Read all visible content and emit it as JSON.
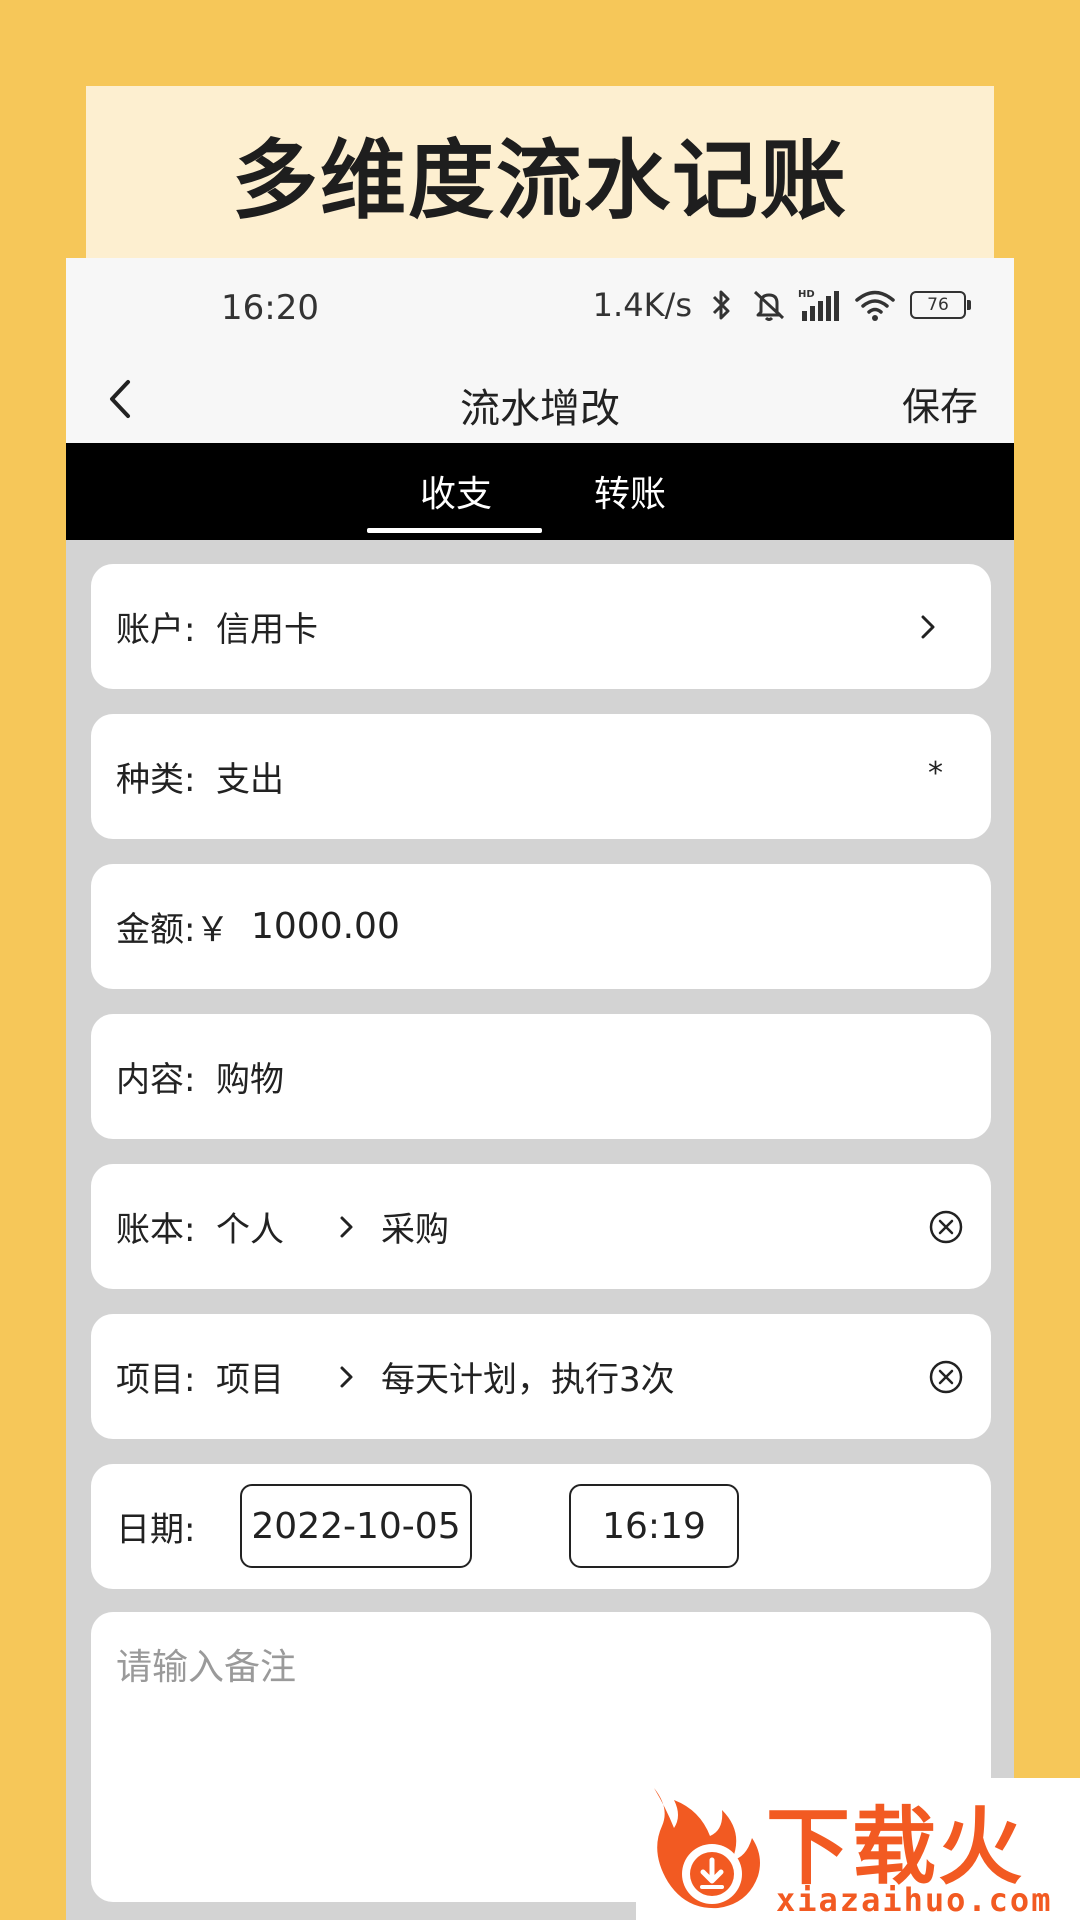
{
  "banner": {
    "title": "多维度流水记账"
  },
  "status_bar": {
    "time": "16:20",
    "speed": "1.4K/s",
    "battery": "76",
    "icons": [
      "bluetooth-icon",
      "mute-icon",
      "hd-signal-icon",
      "wifi-icon",
      "battery-icon"
    ]
  },
  "nav": {
    "title": "流水增改",
    "save": "保存",
    "back_icon": "chevron-left-icon"
  },
  "tabs": [
    {
      "label": "收支",
      "active": true
    },
    {
      "label": "转账",
      "active": false
    }
  ],
  "form": {
    "account": {
      "label": "账户:",
      "value": "信用卡"
    },
    "category": {
      "label": "种类:",
      "value": "支出",
      "marker": "*"
    },
    "amount": {
      "label": "金额:￥",
      "value": "1000.00"
    },
    "content": {
      "label": "内容:",
      "value": "购物"
    },
    "ledger": {
      "label": "账本:",
      "parent": "个人",
      "child": "采购"
    },
    "project": {
      "label": "项目:",
      "parent": "项目",
      "child": "每天计划，执行3次"
    },
    "date": {
      "label": "日期:",
      "date": "2022-10-05",
      "time": "16:19"
    },
    "notes": {
      "placeholder": "请输入备注"
    }
  },
  "watermark": {
    "logo_icon": "fire-download-icon",
    "brand": "下载火",
    "domain": "xiazaihuo.com"
  },
  "colors": {
    "background": "#F6C759",
    "banner_bg": "#FDEFD0",
    "tab_bar": "#000000",
    "content_bg": "#D3D3D3",
    "watermark_orange": "#F25A22"
  }
}
